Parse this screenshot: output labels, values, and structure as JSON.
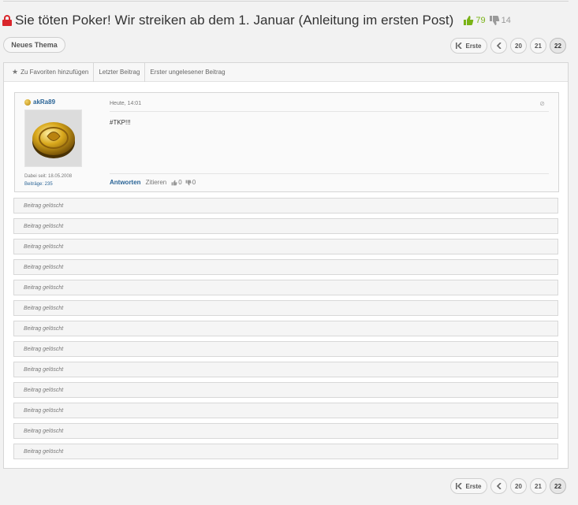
{
  "thread": {
    "title": "Sie töten Poker! Wir streiken ab dem 1. Januar (Anleitung im ersten Post)",
    "likes": "79",
    "dislikes": "14",
    "lock_icon": "lock-icon"
  },
  "actions": {
    "new_thread": "Neues Thema"
  },
  "pagination": {
    "first": "Erste",
    "pages": [
      "20",
      "21",
      "22"
    ],
    "current": "22"
  },
  "toolbar": {
    "favorites": "Zu Favoriten hinzufügen",
    "last_post": "Letzter Beitrag",
    "first_unread": "Erster ungelesener Beitrag"
  },
  "post": {
    "author": "akRa89",
    "member_since": "Dabei seit: 18.05.2008",
    "posts_count": "Beiträge: 235",
    "date": "Heute, 14:01",
    "body": "#TKP!!!",
    "reply": "Antworten",
    "quote": "Zitieren",
    "likes": "0",
    "dislikes": "0"
  },
  "deleted_posts": [
    "Beitrag gelöscht",
    "Beitrag gelöscht",
    "Beitrag gelöscht",
    "Beitrag gelöscht",
    "Beitrag gelöscht",
    "Beitrag gelöscht",
    "Beitrag gelöscht",
    "Beitrag gelöscht",
    "Beitrag gelöscht",
    "Beitrag gelöscht",
    "Beitrag gelöscht",
    "Beitrag gelöscht",
    "Beitrag gelöscht"
  ],
  "colors": {
    "accent_green": "#7ab317",
    "link_blue": "#2a6496",
    "lock_red": "#d9262b"
  }
}
